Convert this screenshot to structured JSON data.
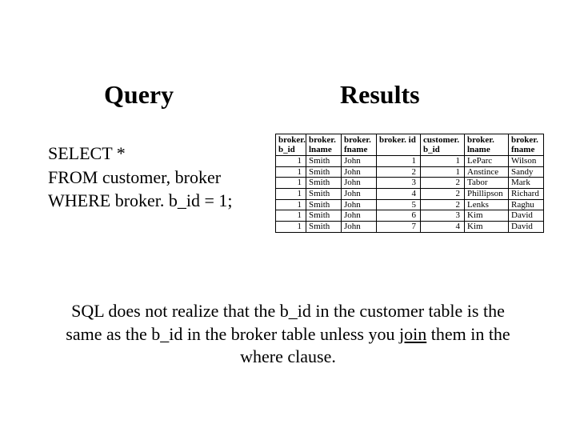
{
  "headings": {
    "query": "Query",
    "results": "Results"
  },
  "query": {
    "line1": "SELECT *",
    "line2": "FROM customer, broker",
    "line3": "WHERE broker. b_id = 1;"
  },
  "table": {
    "headers": {
      "c0a": "broker.",
      "c0b": "b_id",
      "c1a": "broker.",
      "c1b": "lname",
      "c2a": "broker.",
      "c2b": "fname",
      "c3a": "broker. id",
      "c4a": "customer.",
      "c4b": "b_id",
      "c5a": "broker.",
      "c5b": "lname",
      "c6a": "broker.",
      "c6b": "fname"
    },
    "rows": [
      {
        "c0": "1",
        "c1": "Smith",
        "c2": "John",
        "c3": "1",
        "c4": "1",
        "c5": "LeParc",
        "c6": "Wilson"
      },
      {
        "c0": "1",
        "c1": "Smith",
        "c2": "John",
        "c3": "2",
        "c4": "1",
        "c5": "Anstince",
        "c6": "Sandy"
      },
      {
        "c0": "1",
        "c1": "Smith",
        "c2": "John",
        "c3": "3",
        "c4": "2",
        "c5": "Tabor",
        "c6": "Mark"
      },
      {
        "c0": "1",
        "c1": "Smith",
        "c2": "John",
        "c3": "4",
        "c4": "2",
        "c5": "Phillipson",
        "c6": "Richard"
      },
      {
        "c0": "1",
        "c1": "Smith",
        "c2": "John",
        "c3": "5",
        "c4": "2",
        "c5": "Lenks",
        "c6": "Raghu"
      },
      {
        "c0": "1",
        "c1": "Smith",
        "c2": "John",
        "c3": "6",
        "c4": "3",
        "c5": "Kim",
        "c6": "David"
      },
      {
        "c0": "1",
        "c1": "Smith",
        "c2": "John",
        "c3": "7",
        "c4": "4",
        "c5": "Kim",
        "c6": "David"
      }
    ]
  },
  "footer": {
    "t1": "SQL does not realize that the b_id in the customer table is the",
    "t2": "same as the b_id in the broker table unless you ",
    "join": "join",
    "t3": " them in the",
    "t4": "where clause."
  }
}
